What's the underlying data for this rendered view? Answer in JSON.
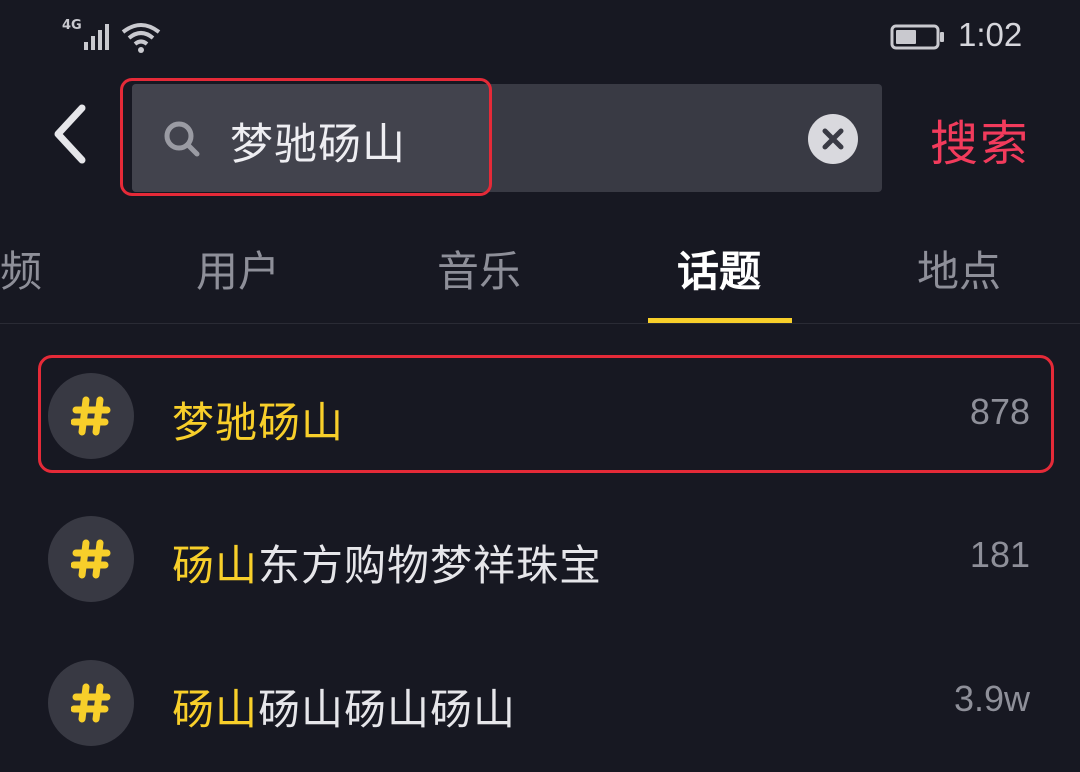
{
  "status_bar": {
    "network": "4G",
    "time": "1:02",
    "icons": [
      "signal-icon",
      "wifi-icon",
      "battery-icon"
    ]
  },
  "search": {
    "query": "梦驰砀山",
    "submit_label": "搜索",
    "icons": {
      "back": "back-arrow-icon",
      "search": "search-icon",
      "clear": "clear-icon"
    }
  },
  "tabs": [
    {
      "label": "频",
      "active": false
    },
    {
      "label": "用户",
      "active": false
    },
    {
      "label": "音乐",
      "active": false
    },
    {
      "label": "话题",
      "active": true
    },
    {
      "label": "地点",
      "active": false
    }
  ],
  "results": [
    {
      "highlight": "梦驰砀山",
      "rest": "",
      "count": "878"
    },
    {
      "highlight": "砀山",
      "rest": "东方购物梦祥珠宝",
      "count": "181"
    },
    {
      "highlight": "砀山",
      "rest": "砀山砀山砀山",
      "count": "3.9w"
    }
  ],
  "colors": {
    "background": "#171822",
    "accent_yellow": "#f8cf2a",
    "accent_red": "#f23b5c",
    "annotation_red": "#e52a38"
  }
}
